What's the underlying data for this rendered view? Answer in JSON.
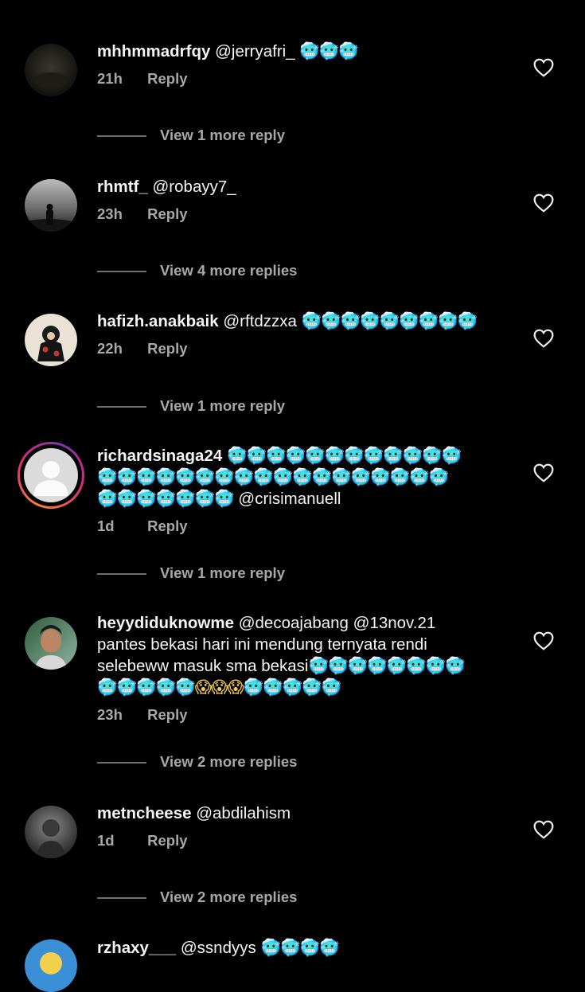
{
  "icons": {
    "like": "heart-outline-icon",
    "reaction": "cold-face-emoji"
  },
  "comments": [
    {
      "username": "mhhmmadrfqy",
      "text": "@jerryafri_",
      "emoji": "🥶🥶🥶",
      "time": "21h",
      "reply": "Reply",
      "view_more": "View 1 more reply"
    },
    {
      "username": "rhmtf_",
      "text": "@robayy7_",
      "time": "23h",
      "reply": "Reply",
      "view_more": "View 4 more replies"
    },
    {
      "username": "hafizh.anakbaik",
      "text": "@rftdzzxa",
      "emoji": "🥶🥶🥶🥶🥶🥶🥶🥶🥶",
      "time": "22h",
      "reply": "Reply",
      "view_more": "View 1 more reply"
    },
    {
      "username": "richardsinaga24",
      "emoji_a": "🥶🥶🥶🥶🥶🥶🥶🥶🥶🥶🥶🥶",
      "emoji_b": "🥶🥶🥶🥶🥶🥶🥶🥶🥶🥶🥶🥶🥶🥶🥶🥶🥶🥶",
      "emoji_c": "🥶🥶🥶🥶🥶🥶🥶",
      "text_end": "@crisimanuell",
      "time": "1d",
      "reply": "Reply",
      "view_more": "View 1 more reply"
    },
    {
      "username": "heyydiduknowme",
      "text": "@decoajabang @13nov.21",
      "line2": "pantes bekasi hari ini mendung ternyata rendi",
      "line3": "selebeww masuk sma bekasi",
      "emoji_a": "🥶🥶🥶🥶🥶🥶🥶🥶",
      "emoji_b": "🥶🥶🥶🥶🥶",
      "emoji_scream": "😱😱😱",
      "emoji_c": "🥶🥶🥶🥶🥶",
      "time": "23h",
      "reply": "Reply",
      "view_more": "View 2 more replies"
    },
    {
      "username": "metncheese",
      "text": "@abdilahism",
      "time": "1d",
      "reply": "Reply",
      "view_more": "View 2 more replies"
    },
    {
      "username": "rzhaxy___",
      "text": "@ssndyys",
      "emoji": "🥶🥶🥶🥶"
    }
  ]
}
